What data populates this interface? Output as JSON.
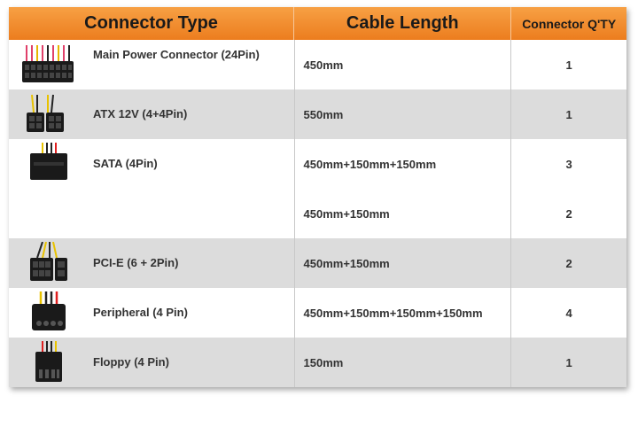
{
  "headers": {
    "type": "Connector Type",
    "length": "Cable Length",
    "qty": "Connector Q'TY"
  },
  "rows": [
    {
      "name": "Main Power Connector (24Pin)",
      "length": "450mm",
      "qty": "1",
      "icon": "atx-24pin-connector-icon"
    },
    {
      "name": "ATX 12V (4+4Pin)",
      "length": "550mm",
      "qty": "1",
      "icon": "atx12v-connector-icon"
    },
    {
      "name": "SATA (4Pin)",
      "length": "450mm+150mm+150mm",
      "qty": "3",
      "icon": "sata-connector-icon"
    },
    {
      "name": "",
      "length": "450mm+150mm",
      "qty": "2",
      "icon": ""
    },
    {
      "name": "PCI-E (6 + 2Pin)",
      "length": "450mm+150mm",
      "qty": "2",
      "icon": "pcie-connector-icon"
    },
    {
      "name": "Peripheral (4 Pin)",
      "length": "450mm+150mm+150mm+150mm",
      "qty": "4",
      "icon": "molex-connector-icon"
    },
    {
      "name": "Floppy (4 Pin)",
      "length": "150mm",
      "qty": "1",
      "icon": "floppy-connector-icon"
    }
  ],
  "colors": {
    "header_orange": "#ec7d1e",
    "row_grey": "#dcdcdc"
  }
}
